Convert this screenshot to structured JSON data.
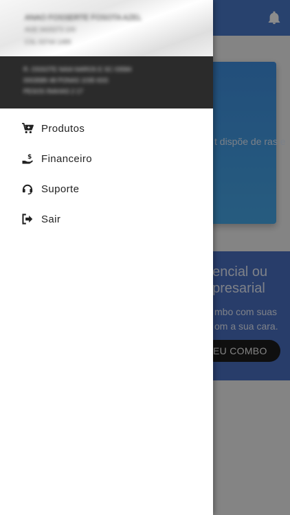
{
  "account": {
    "name": "ANAO FOSSERTE FOSOTA AZEL",
    "id_line": "AGE 0415273 100",
    "meta_line": "CSL 03744 1489"
  },
  "address": {
    "line1": "R. OSSOTE NAIA NAROS E SC 03584",
    "line2": "0003589 48 PONAS 1035 6SS",
    "line3": "PESOS INAHAS 2 17"
  },
  "menu": [
    {
      "label": "Produtos",
      "icon": "cart-icon"
    },
    {
      "label": "Financeiro",
      "icon": "hand-money-icon"
    },
    {
      "label": "Suporte",
      "icon": "headset-icon"
    },
    {
      "label": "Sair",
      "icon": "logout-icon"
    }
  ],
  "background": {
    "card1_text": "t dispõe de ras e",
    "card2_title_line1": "dencial ou",
    "card2_title_line2": "npresarial",
    "card2_sub_line1": "mbo com suas",
    "card2_sub_line2": "om a sua cara.",
    "combo_button": "EU COMBO"
  },
  "colors": {
    "header_blue": "#4a78c9",
    "drawer_dark": "#2b2b2b",
    "card_blue": "#46a8e8"
  }
}
